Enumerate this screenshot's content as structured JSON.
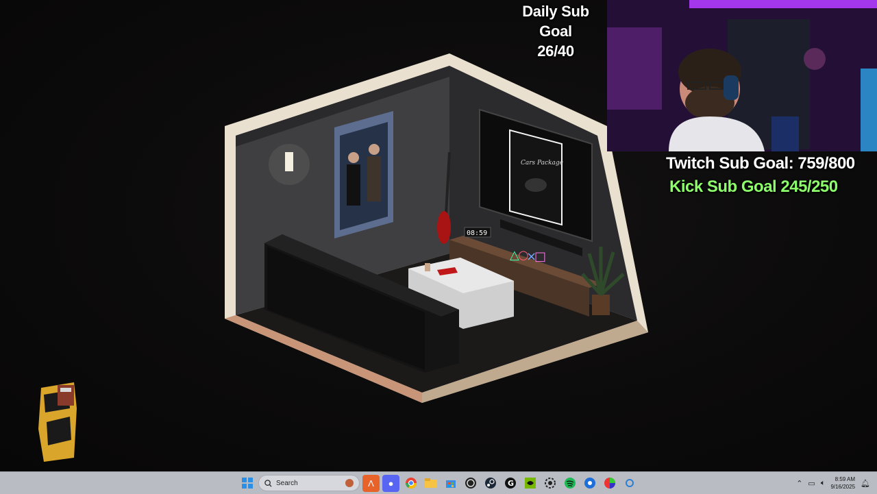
{
  "overlay": {
    "daily_goal_title": "Daily Sub Goal",
    "daily_goal_value": "26/40",
    "twitch_goal": "Twitch Sub Goal: 759/800",
    "kick_goal": "Kick Sub Goal  245/250"
  },
  "room": {
    "clock_text": "08:59",
    "poster_caption": "Cars Package"
  },
  "taskbar": {
    "search_placeholder": "Search",
    "time": "8:59 AM",
    "date": "9/16/2025",
    "apps": [
      "start-icon",
      "search",
      "terminal-icon",
      "discord-icon",
      "chrome-icon",
      "file-explorer-icon",
      "store-icon",
      "obs-icon",
      "steam-icon",
      "ghub-icon",
      "nvidia-icon",
      "settings-icon",
      "spotify-icon",
      "network-app-icon",
      "color-picker-icon",
      "app-icon"
    ]
  },
  "colors": {
    "accent_kick": "#8cff6a",
    "room_wall": "#3a3a3c",
    "taskbar_bg": "#b9bcc3"
  }
}
